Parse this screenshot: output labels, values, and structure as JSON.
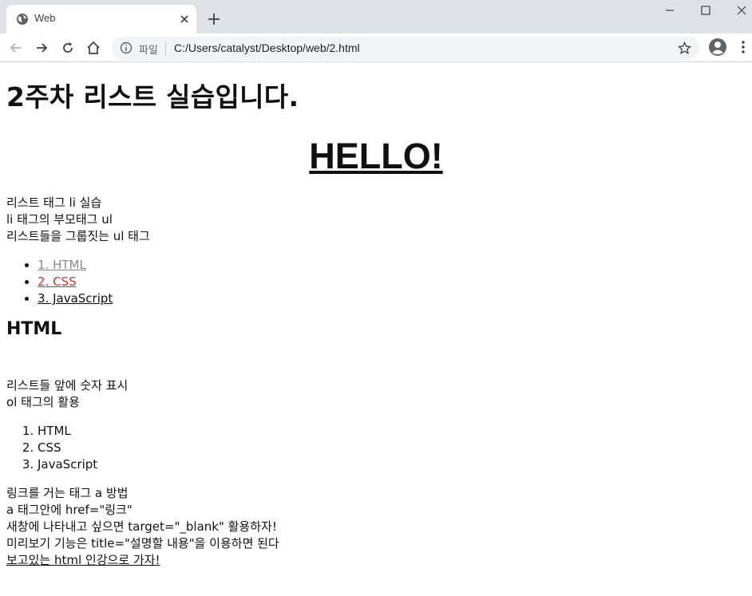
{
  "browser": {
    "tab_title": "Web",
    "scheme_label": "파일",
    "url": "C:/Users/catalyst/Desktop/web/2.html"
  },
  "page": {
    "title": "2주차 리스트 실습입니다.",
    "hello": "HELLO!",
    "intro_lines": [
      "리스트 태그 li 실습",
      "li 태그의 부모태그 ul",
      "리스트들을 그룹짓는 ul 태그"
    ],
    "ul_items": [
      "1. HTML",
      "2. CSS",
      "3. JavaScript"
    ],
    "section_heading": "HTML",
    "ol_intro_lines": [
      "리스트들 앞에 숫자 표시",
      "ol 태그의 활용"
    ],
    "ol_items": [
      "HTML",
      "CSS",
      "JavaScript"
    ],
    "link_lines": [
      "링크를 거는 태그 a 방법",
      "a 태그안에 href=\"링크\"",
      "새창에 나타내고 싶으면 target=\"_blank\" 활용하자!",
      "미리보기 기능은 title=\"설명할 내용\"을 이용하면 된다"
    ],
    "final_link": "보고있는 html 인강으로 가자!"
  },
  "colors": {
    "tabstrip_bg": "#dee1e6",
    "omnibox_bg": "#f1f3f4",
    "visited_link": "#8a8a8a",
    "active_link": "#d93025"
  },
  "icons": [
    "globe-icon",
    "close-icon",
    "plus-icon",
    "minimize-icon",
    "maximize-icon",
    "window-close-icon",
    "back-arrow-icon",
    "forward-arrow-icon",
    "reload-icon",
    "home-icon",
    "info-icon",
    "star-icon",
    "profile-icon",
    "menu-dots-icon"
  ]
}
